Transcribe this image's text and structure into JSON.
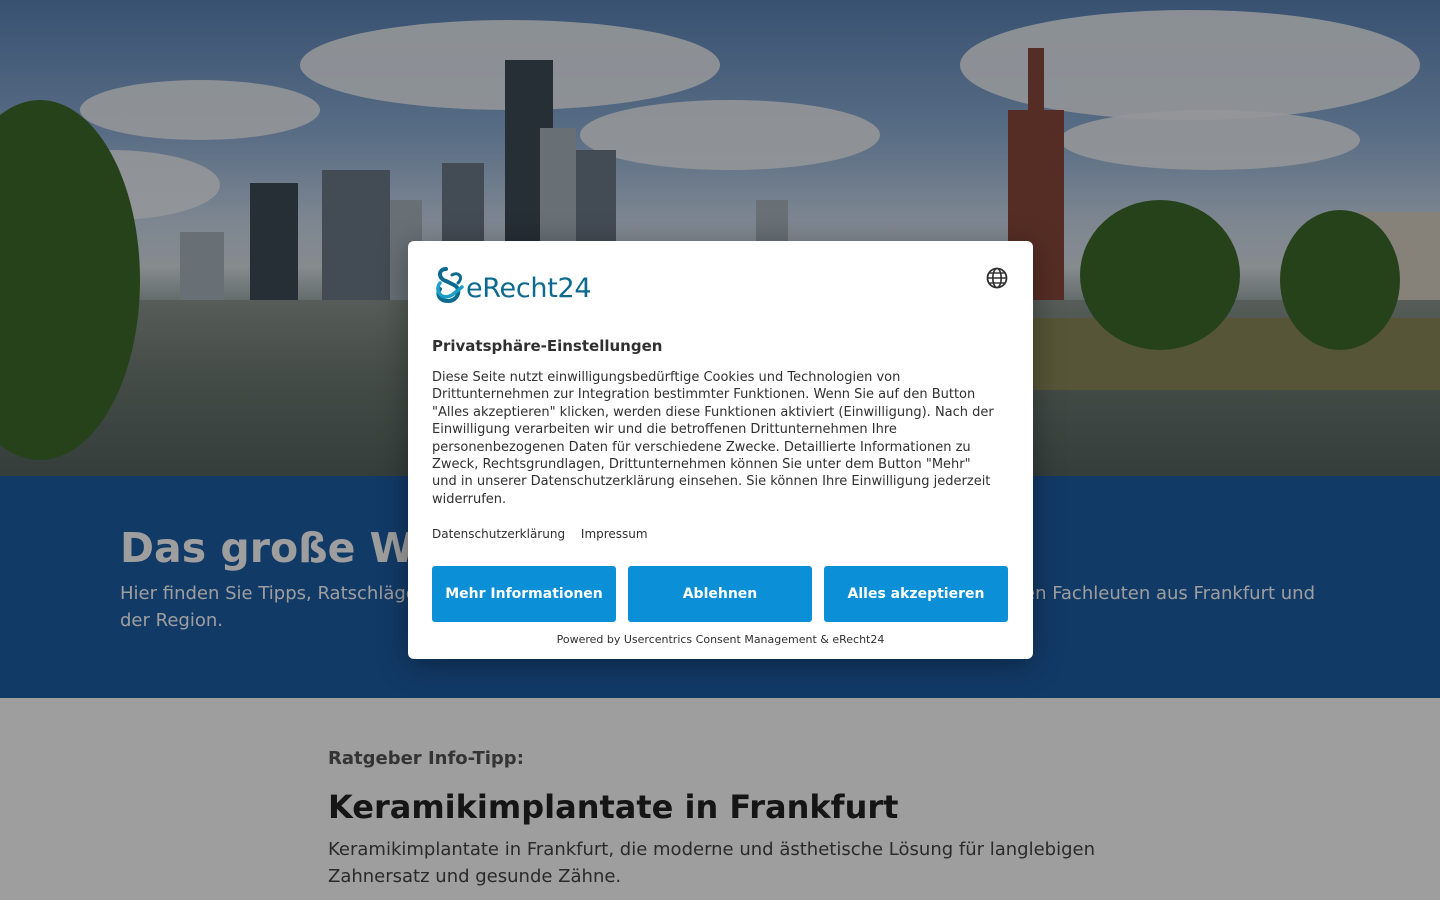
{
  "page": {
    "heading": "Das große W",
    "intro_left": "Hier finden Sie Tipps, Ratschläge",
    "intro_right": "en Fachleuten aus Frankfurt und",
    "intro_line2": "der Region.",
    "kicker": "Ratgeber Info-Tipp:",
    "article_title": "Keramikimplantate in Frankfurt",
    "article_lead": "Keramikimplantate in Frankfurt, die moderne und ästhetische Lösung für langlebigen Zahnersatz und gesunde Zähne."
  },
  "consent": {
    "logo_text": "eRecht24",
    "title": "Privatsphäre-Einstellungen",
    "text": "Diese Seite nutzt einwilligungsbedürftige Cookies und Technologien von Drittunternehmen zur Integration bestimmter Funktionen. Wenn Sie auf den Button \"Alles akzeptieren\" klicken, werden diese Funktionen aktiviert (Einwilligung). Nach der Einwilligung verarbeiten wir und die betroffenen Drittunternehmen Ihre personenbezogenen Daten für verschiedene Zwecke. Detaillierte Informationen zu Zweck, Rechtsgrundlagen, Drittunternehmen können Sie unter dem Button \"Mehr\" und in unserer Datenschutzerklärung einsehen. Sie können Ihre Einwilligung jederzeit widerrufen.",
    "link_privacy": "Datenschutzerklärung",
    "link_imprint": "Impressum",
    "btn_more": "Mehr Informationen",
    "btn_decline": "Ablehnen",
    "btn_accept": "Alles akzeptieren",
    "powered_by": "Powered by Usercentrics Consent Management & eRecht24"
  },
  "colors": {
    "band": "#1d5ea6",
    "button": "#0b8fd7",
    "logo": "#0b6a8e"
  },
  "icons": {
    "language": "globe-icon",
    "logo": "erecht24-logo-icon"
  }
}
